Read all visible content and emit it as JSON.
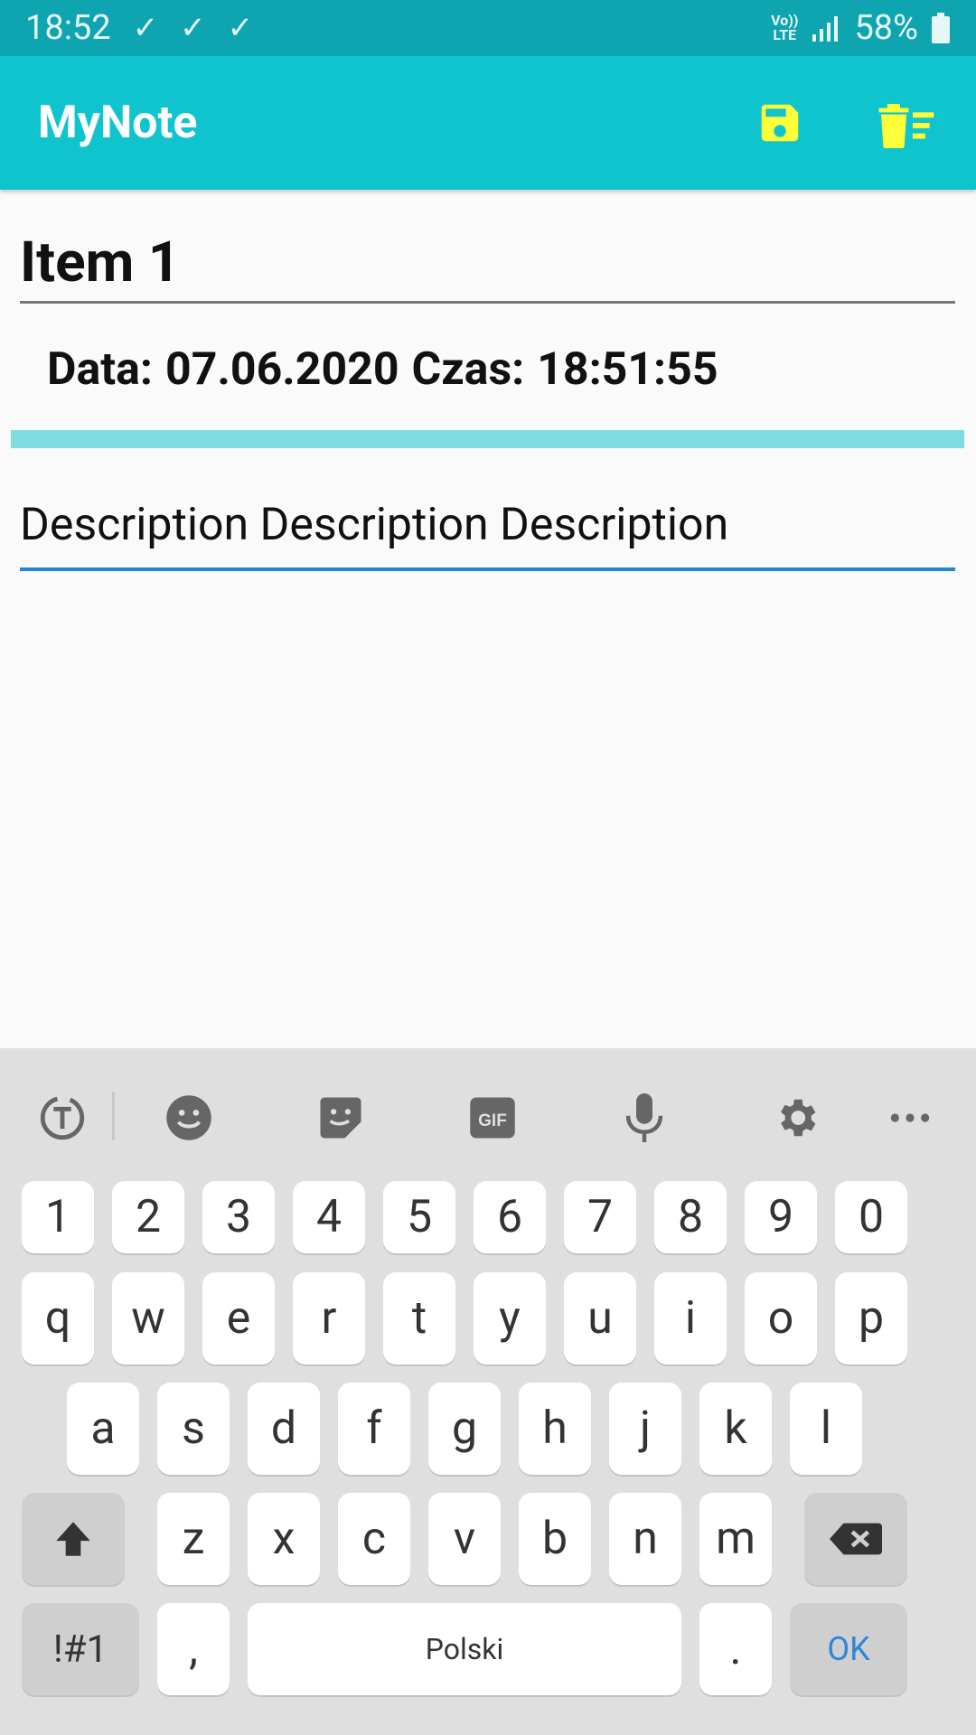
{
  "status_bar": {
    "time": "18:52",
    "notifications": [
      "check-icon",
      "check-icon",
      "check-icon"
    ],
    "network_label": "Vo)) LTE",
    "battery": "58%"
  },
  "app_bar": {
    "title": "MyNote",
    "actions": [
      {
        "icon": "save-icon",
        "color": "#ffff3a"
      },
      {
        "icon": "delete-sweep-icon",
        "color": "#ffff3a"
      }
    ]
  },
  "note": {
    "title": "Item 1",
    "date_label": "Data:",
    "date_value": "07.06.2020",
    "time_label": "Czas:",
    "time_value": "18:51:55",
    "description": "Description Description Description"
  },
  "keyboard": {
    "toolbar": [
      "text-translate-icon",
      "emoji-icon",
      "sticker-icon",
      "gif-icon",
      "microphone-icon",
      "settings-icon",
      "more-icon"
    ],
    "row_numbers": [
      "1",
      "2",
      "3",
      "4",
      "5",
      "6",
      "7",
      "8",
      "9",
      "0"
    ],
    "row_1": [
      "q",
      "w",
      "e",
      "r",
      "t",
      "y",
      "u",
      "i",
      "o",
      "p"
    ],
    "row_2": [
      "a",
      "s",
      "d",
      "f",
      "g",
      "h",
      "j",
      "k",
      "l"
    ],
    "row_3": [
      "z",
      "x",
      "c",
      "v",
      "b",
      "n",
      "m"
    ],
    "symbols_label": "!#1",
    "comma_label": ",",
    "space_label": "Polski",
    "period_label": ".",
    "ok_label": "OK"
  },
  "colors": {
    "status_bar": "#0ea5b0",
    "app_bar": "#10c4ce",
    "accent_icons": "#ffff3a",
    "divider": "#7fdbe0",
    "focus_underline": "#1e88d6"
  }
}
